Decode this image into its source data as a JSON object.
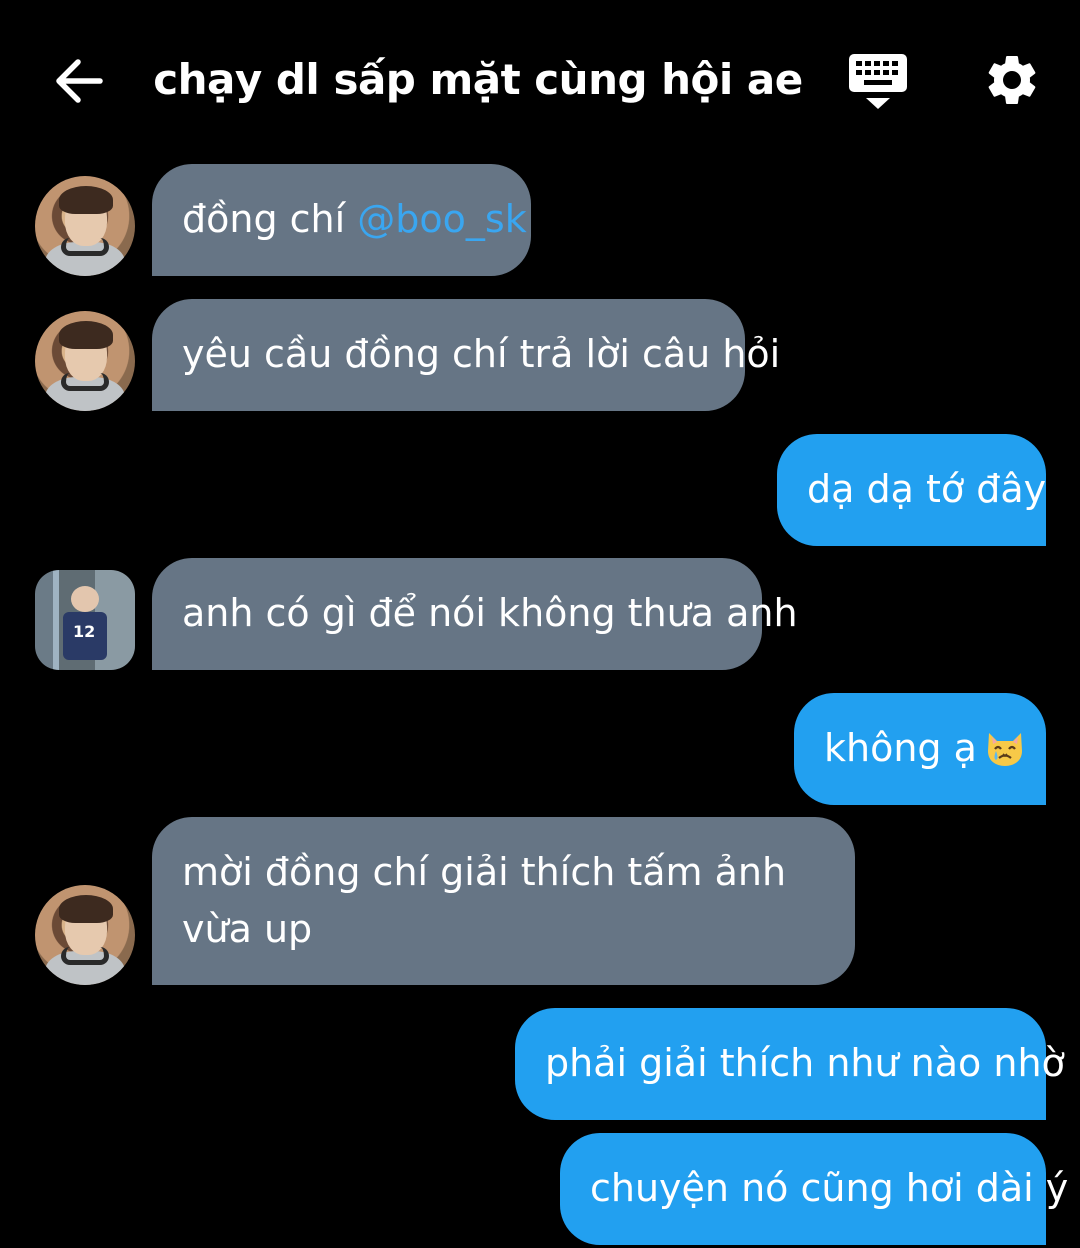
{
  "header": {
    "title": "chạy dl sấp mặt cùng hội ae",
    "back_icon": "arrow-left-icon",
    "keyboard_icon": "keyboard-hide-icon",
    "settings_icon": "gear-icon"
  },
  "messages": [
    {
      "direction": "incoming",
      "avatar": "avatar-user-1",
      "prefix": "đồng chí ",
      "mention": "@boo_sk"
    },
    {
      "direction": "incoming",
      "avatar": "avatar-user-1",
      "text": "yêu cầu đồng chí trả lời câu hỏi"
    },
    {
      "direction": "outgoing",
      "text": "dạ dạ tớ đây"
    },
    {
      "direction": "incoming",
      "avatar": "avatar-user-2",
      "text": "anh có gì để nói không thưa anh"
    },
    {
      "direction": "outgoing",
      "text": "không ạ",
      "emoji": "crying-cat-emoji"
    },
    {
      "direction": "incoming",
      "avatar": "avatar-user-1",
      "text": "mời đồng chí giải thích tấm ảnh vừa up"
    },
    {
      "direction": "outgoing",
      "text": "phải giải thích như nào nhờ"
    },
    {
      "direction": "outgoing",
      "text": "chuyện nó cũng hơi dài ý"
    }
  ],
  "colors": {
    "background": "#000000",
    "incoming_bubble": "#667585",
    "outgoing_bubble": "#22a0f0",
    "mention": "#3aa6f0"
  }
}
